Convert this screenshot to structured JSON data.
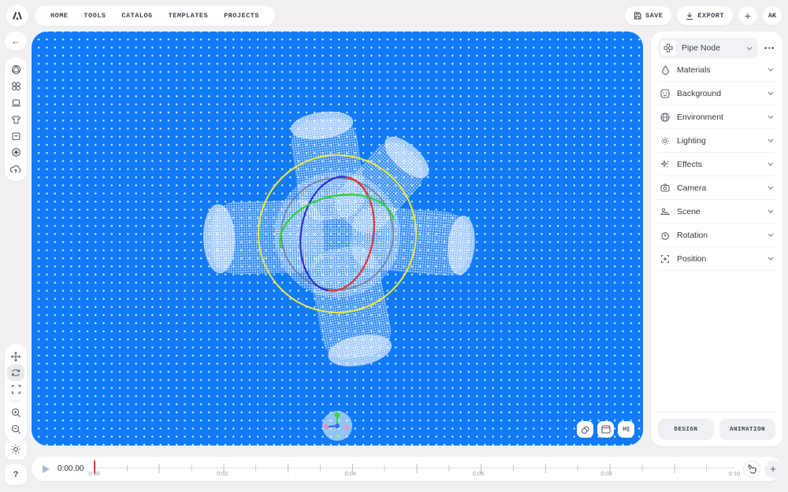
{
  "topbar": {
    "nav": [
      "HOME",
      "TOOLS",
      "CATALOG",
      "TEMPLATES",
      "PROJECTS"
    ],
    "save_label": "SAVE",
    "export_label": "EXPORT",
    "add_label": "+",
    "avatar": "AK"
  },
  "icons": {
    "back": "←",
    "help": "?",
    "add": "+"
  },
  "canvas": {
    "hq_label": "HQ"
  },
  "right_panel": {
    "node_selector": {
      "label": "Pipe Node"
    },
    "sections": [
      {
        "label": "Materials"
      },
      {
        "label": "Background"
      },
      {
        "label": "Environment"
      },
      {
        "label": "Lighting"
      },
      {
        "label": "Effects"
      },
      {
        "label": "Camera"
      },
      {
        "label": "Scene"
      },
      {
        "label": "Rotation"
      },
      {
        "label": "Position"
      }
    ],
    "tabs": [
      {
        "label": "DESIGN"
      },
      {
        "label": "ANIMATION"
      }
    ]
  },
  "timeline": {
    "current_time": "0:00.00",
    "ticks": [
      "0:00",
      "0:02",
      "0:04",
      "0:06",
      "0:08",
      "0:10"
    ],
    "playhead_color": "#e0352b"
  },
  "colors": {
    "canvas_blue": "#117bfa",
    "gizmo_yellow": "#efea3e",
    "gizmo_red": "#e5332c",
    "gizmo_green": "#2ed13b",
    "gizmo_blue": "#2a2fd8"
  }
}
